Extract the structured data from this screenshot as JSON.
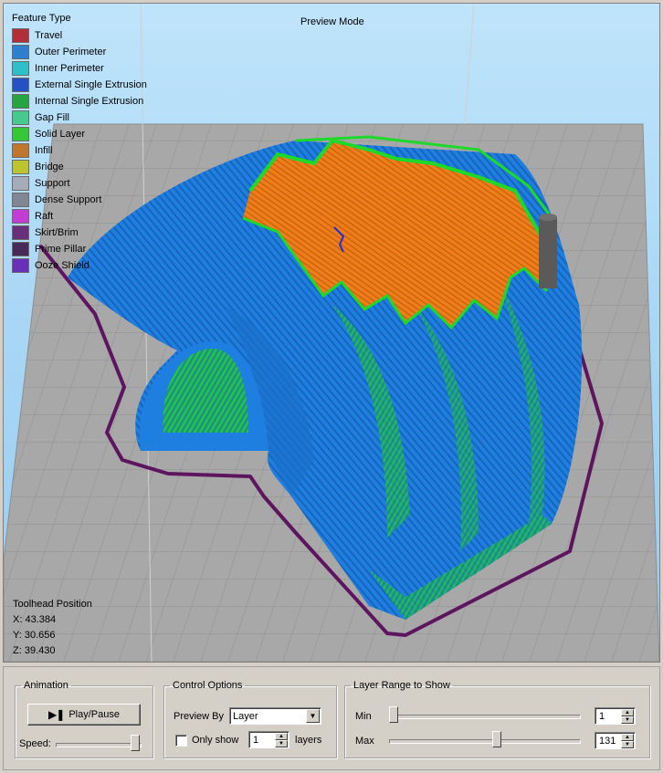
{
  "viewport": {
    "legend_title": "Feature Type",
    "preview_mode_label": "Preview Mode",
    "legend": [
      {
        "label": "Travel",
        "color": "#b22f3a"
      },
      {
        "label": "Outer Perimeter",
        "color": "#2f7fd0"
      },
      {
        "label": "Inner Perimeter",
        "color": "#2ec0c8"
      },
      {
        "label": "External Single Extrusion",
        "color": "#2451c4"
      },
      {
        "label": "Internal Single Extrusion",
        "color": "#25a440"
      },
      {
        "label": "Gap Fill",
        "color": "#45c98e"
      },
      {
        "label": "Solid Layer",
        "color": "#35c835"
      },
      {
        "label": "Infill",
        "color": "#c0762d"
      },
      {
        "label": "Bridge",
        "color": "#bcc430"
      },
      {
        "label": "Support",
        "color": "#a4acb8"
      },
      {
        "label": "Dense Support",
        "color": "#7f8794"
      },
      {
        "label": "Raft",
        "color": "#c23ed2"
      },
      {
        "label": "Skirt/Brim",
        "color": "#6a2f7a"
      },
      {
        "label": "Prime Pillar",
        "color": "#452a5a"
      },
      {
        "label": "Ooze Shield",
        "color": "#6a2fb8"
      }
    ],
    "toolhead": {
      "title": "Toolhead Position",
      "x": "X: 43.384",
      "y": "Y: 30.656",
      "z": "Z: 39.430"
    }
  },
  "animation": {
    "group_label": "Animation",
    "play_label": "Play/Pause",
    "speed_label": "Speed:",
    "speed_fraction": 1.0
  },
  "control_options": {
    "group_label": "Control Options",
    "preview_by_label": "Preview By",
    "preview_by_value": "Layer",
    "only_show_label": "Only show",
    "only_show_checked": false,
    "only_show_value": "1",
    "layers_label": "layers"
  },
  "layer_range": {
    "group_label": "Layer Range to Show",
    "min_label": "Min",
    "min_value": "1",
    "max_label": "Max",
    "max_value": "131",
    "total_layers": 229
  },
  "colors": {
    "infill": "#f07d1a",
    "outer_perimeter": "#1f82e0",
    "solid_layer": "#1ed82a",
    "skirt": "#5e1560",
    "bed": "#a8a8a8",
    "bed_grid": "#8e8e8e"
  }
}
